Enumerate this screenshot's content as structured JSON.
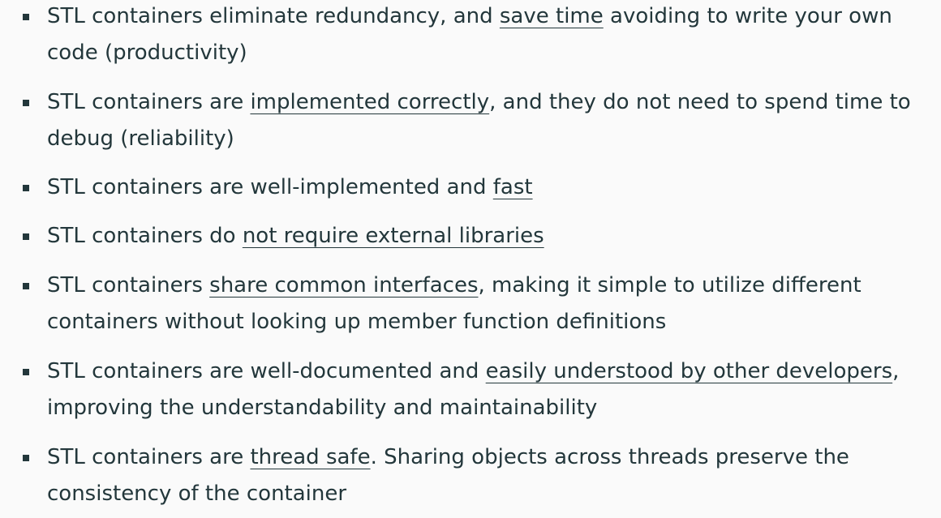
{
  "bullets": [
    {
      "before": "STL containers eliminate redundancy, and ",
      "emph": "save time",
      "after": " avoiding to write your own code (productivity)"
    },
    {
      "before": "STL containers are ",
      "emph": "implemented correctly",
      "after": ", and they do not need to spend time to debug (reliability)"
    },
    {
      "before": "STL containers are well-implemented and ",
      "emph": "fast",
      "after": ""
    },
    {
      "before": "STL containers do ",
      "emph": "not require external libraries",
      "after": ""
    },
    {
      "before": "STL containers ",
      "emph": "share common interfaces",
      "after": ", making it simple to utilize different containers without looking up member function definitions"
    },
    {
      "before": "STL containers are well-documented and ",
      "emph": "easily understood by other developers",
      "after": ", improving the understandability and maintainability"
    },
    {
      "before": "STL containers are ",
      "emph": "thread safe",
      "after": ". Sharing objects across threads preserve the consistency of the container"
    }
  ]
}
